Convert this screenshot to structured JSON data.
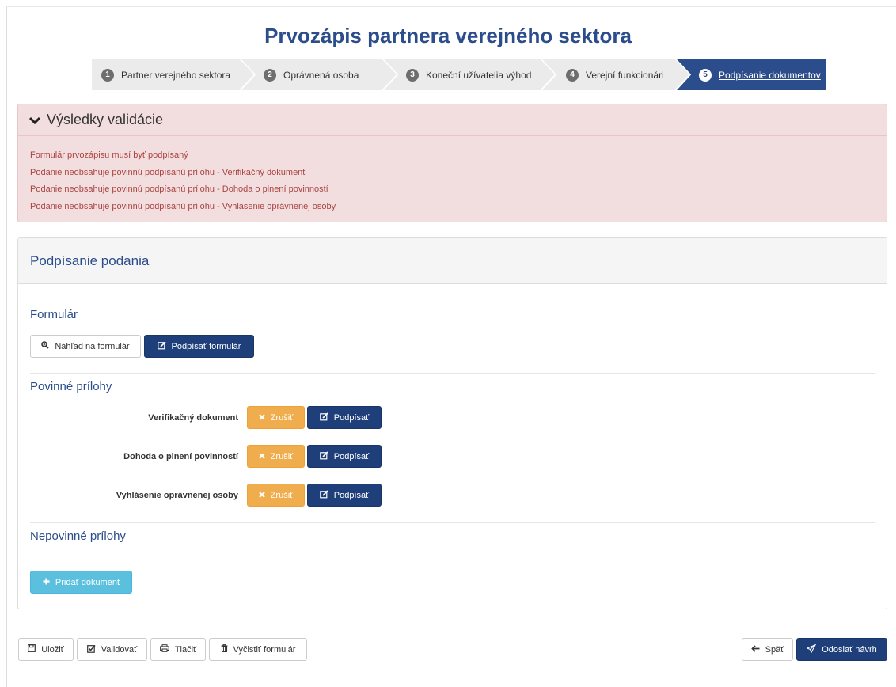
{
  "page": {
    "title": "Prvozápis partnera verejného sektora"
  },
  "wizard": {
    "steps": [
      {
        "num": "1",
        "label": "Partner verejného sektora"
      },
      {
        "num": "2",
        "label": "Oprávnená osoba"
      },
      {
        "num": "3",
        "label": "Koneční užívatelia výhod"
      },
      {
        "num": "4",
        "label": "Verejní funkcionári"
      },
      {
        "num": "5",
        "label": "Podpísanie dokumentov"
      }
    ],
    "active_step": "5"
  },
  "validation": {
    "title": "Výsledky validácie",
    "messages": [
      "Formulár prvozápisu musí byť podpísaný",
      "Podanie neobsahuje povinnú podpísanú prílohu - Verifikačný dokument",
      "Podanie neobsahuje povinnú podpísanú prílohu - Dohoda o plnení povinností",
      "Podanie neobsahuje povinnú podpísanú prílohu - Vyhlásenie oprávnenej osoby"
    ]
  },
  "signing": {
    "title": "Podpísanie podania",
    "form_section": {
      "title": "Formulár",
      "preview_label": "Náhľad na formulár",
      "sign_label": "Podpísať formulár"
    },
    "required_section": {
      "title": "Povinné prílohy",
      "attachments": [
        {
          "label": "Verifikačný dokument",
          "cancel": "Zrušiť",
          "sign": "Podpísať"
        },
        {
          "label": "Dohoda o plnení povinností",
          "cancel": "Zrušiť",
          "sign": "Podpísať"
        },
        {
          "label": "Vyhlásenie oprávnenej osoby",
          "cancel": "Zrušiť",
          "sign": "Podpísať"
        }
      ]
    },
    "optional_section": {
      "title": "Nepovinné prílohy",
      "add_label": "Pridať dokument"
    }
  },
  "footer": {
    "save": "Uložiť",
    "validate": "Validovať",
    "print": "Tlačiť",
    "clear": "Vyčistiť formulár",
    "back": "Späť",
    "submit": "Odoslať návrh"
  },
  "colors": {
    "primary": "#1f3f7a",
    "title_blue": "#2c4d8c",
    "warning": "#f0ad4e",
    "info": "#5bc0de",
    "danger_bg": "#f2dede",
    "danger_text": "#a94442"
  },
  "icons": {
    "chevron": "chevron-down-icon",
    "search": "zoom-in-icon",
    "edit": "edit-icon",
    "close": "close-icon",
    "plus": "plus-icon",
    "save": "floppy-disk-icon",
    "check": "check-square-icon",
    "print": "print-icon",
    "trash": "trash-icon",
    "arrow_left": "arrow-left-icon",
    "send": "paper-plane-icon"
  }
}
